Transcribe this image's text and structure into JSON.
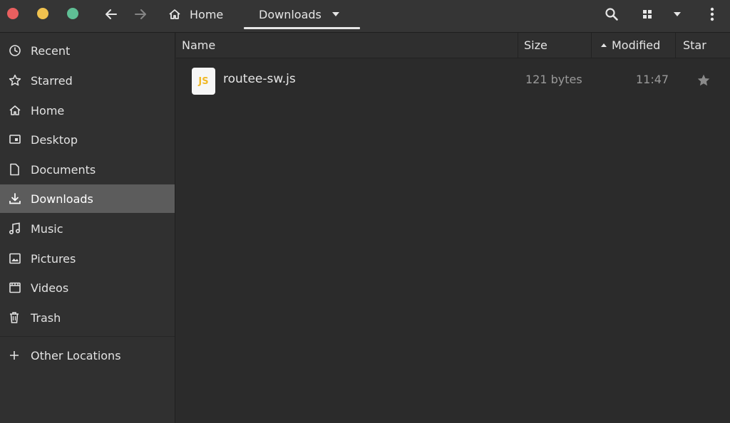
{
  "headerbar": {
    "breadcrumb": {
      "home_label": "Home",
      "current_label": "Downloads"
    }
  },
  "sidebar": {
    "items": [
      {
        "label": "Recent",
        "icon": "clock-icon"
      },
      {
        "label": "Starred",
        "icon": "star-icon"
      },
      {
        "label": "Home",
        "icon": "home-icon"
      },
      {
        "label": "Desktop",
        "icon": "desktop-icon"
      },
      {
        "label": "Documents",
        "icon": "document-icon"
      },
      {
        "label": "Downloads",
        "icon": "download-icon",
        "active": true
      },
      {
        "label": "Music",
        "icon": "music-icon"
      },
      {
        "label": "Pictures",
        "icon": "pictures-icon"
      },
      {
        "label": "Videos",
        "icon": "video-icon"
      },
      {
        "label": "Trash",
        "icon": "trash-icon"
      }
    ],
    "other_locations": "Other Locations"
  },
  "columns": {
    "name": "Name",
    "size": "Size",
    "modified": "Modified",
    "star": "Star"
  },
  "files": [
    {
      "icon_text": "JS",
      "name": "routee-sw.js",
      "size": "121 bytes",
      "modified": "11:47"
    }
  ],
  "colors": {
    "close": "#e95f5f",
    "minimize": "#f0c24f",
    "maximize": "#5fbf95",
    "active_sidebar": "#5c5c5c",
    "js_icon": "#f0b928"
  }
}
